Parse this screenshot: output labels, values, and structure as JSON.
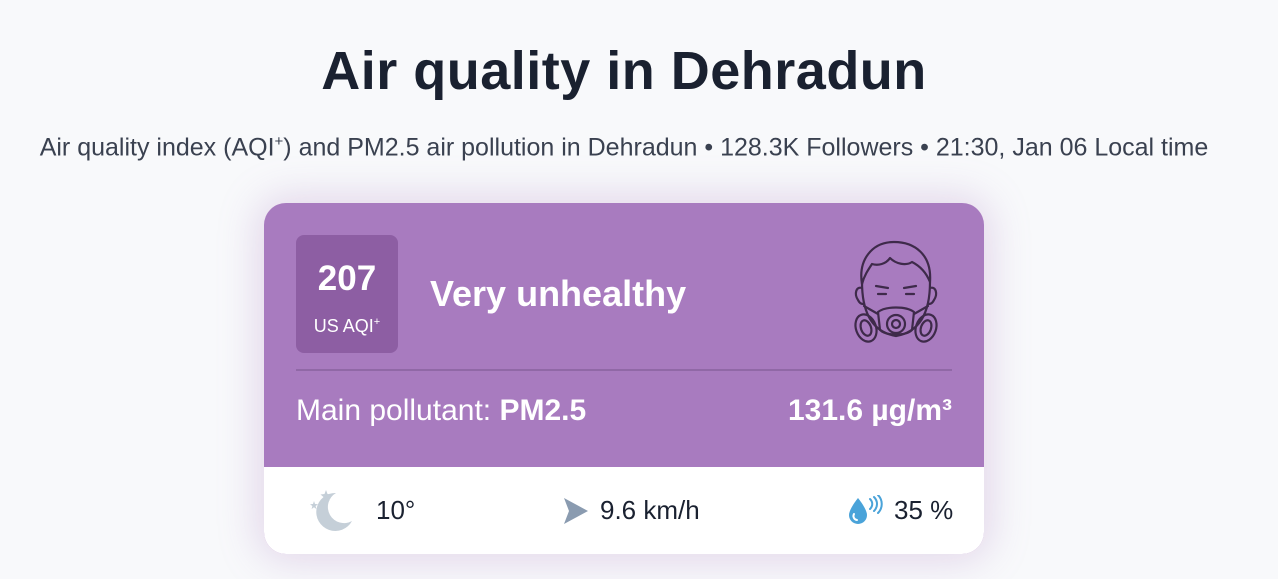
{
  "header": {
    "title": "Air quality in Dehradun",
    "subtitle_pre": "Air quality index (AQI",
    "subtitle_sup": "+",
    "subtitle_post": ") and PM2.5 air pollution in Dehradun • 128.3K Followers • 21:30, Jan 06 Local time"
  },
  "aqi_card": {
    "aqi_value": "207",
    "aqi_unit": "US AQI",
    "aqi_unit_sup": "+",
    "status": "Very unhealthy",
    "status_icon": "gas-mask-face-icon",
    "main_pollutant_label": "Main pollutant: ",
    "main_pollutant": "PM2.5",
    "concentration": "131.6 µg/m³",
    "background_color": "#a87bbf",
    "badge_color": "#8d5ea3"
  },
  "weather": {
    "temperature": "10°",
    "temperature_icon": "moon-stars-icon",
    "wind_speed": "9.6 km/h",
    "wind_icon": "wind-direction-arrow-icon",
    "humidity": "35 %",
    "humidity_icon": "humidity-drop-icon"
  }
}
